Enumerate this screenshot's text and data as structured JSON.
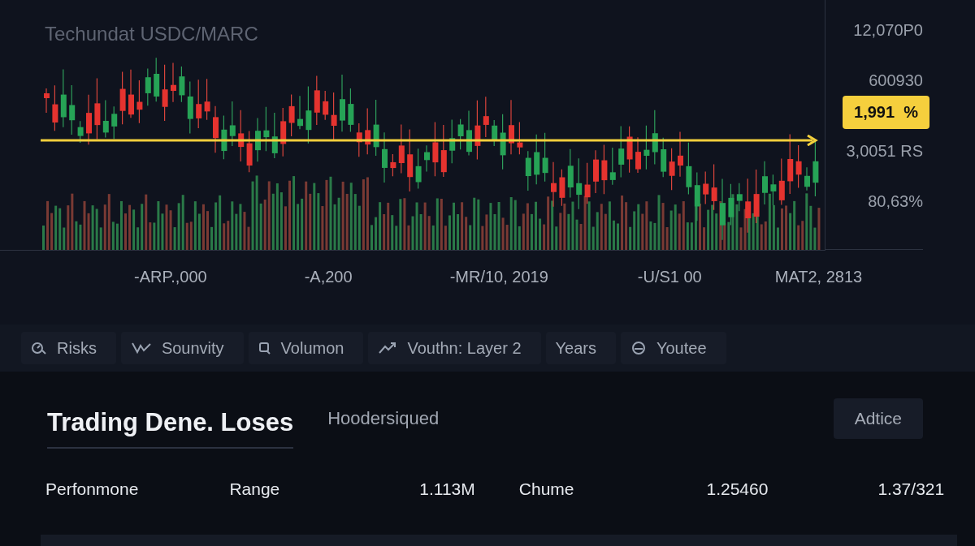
{
  "chart": {
    "title": "Techundat USDC/MARC",
    "y_axis_labels": [
      "12,070P0",
      "600930",
      "3,0051 RS",
      "80,63%"
    ],
    "price_tag": "1,991  %",
    "x_axis_labels": [
      "-ARP.,000",
      "-A,200",
      "-MR/10, 2019",
      "-U/S1  00",
      "MAT2, 2813"
    ]
  },
  "tabs": [
    {
      "label": "Risks"
    },
    {
      "label": "Sounvity"
    },
    {
      "label": "Volumon"
    },
    {
      "label": "Vouthn: Layer 2"
    },
    {
      "label": "Years"
    },
    {
      "label": "Youtee"
    }
  ],
  "section": {
    "title": "Trading Dene. Loses",
    "subtitle": "Hoodersiqued",
    "button": "Adtice"
  },
  "stats_row": [
    "Perfonmone",
    "Range",
    "1.113M",
    "Chume",
    "1.25460",
    "1.37/321"
  ]
}
